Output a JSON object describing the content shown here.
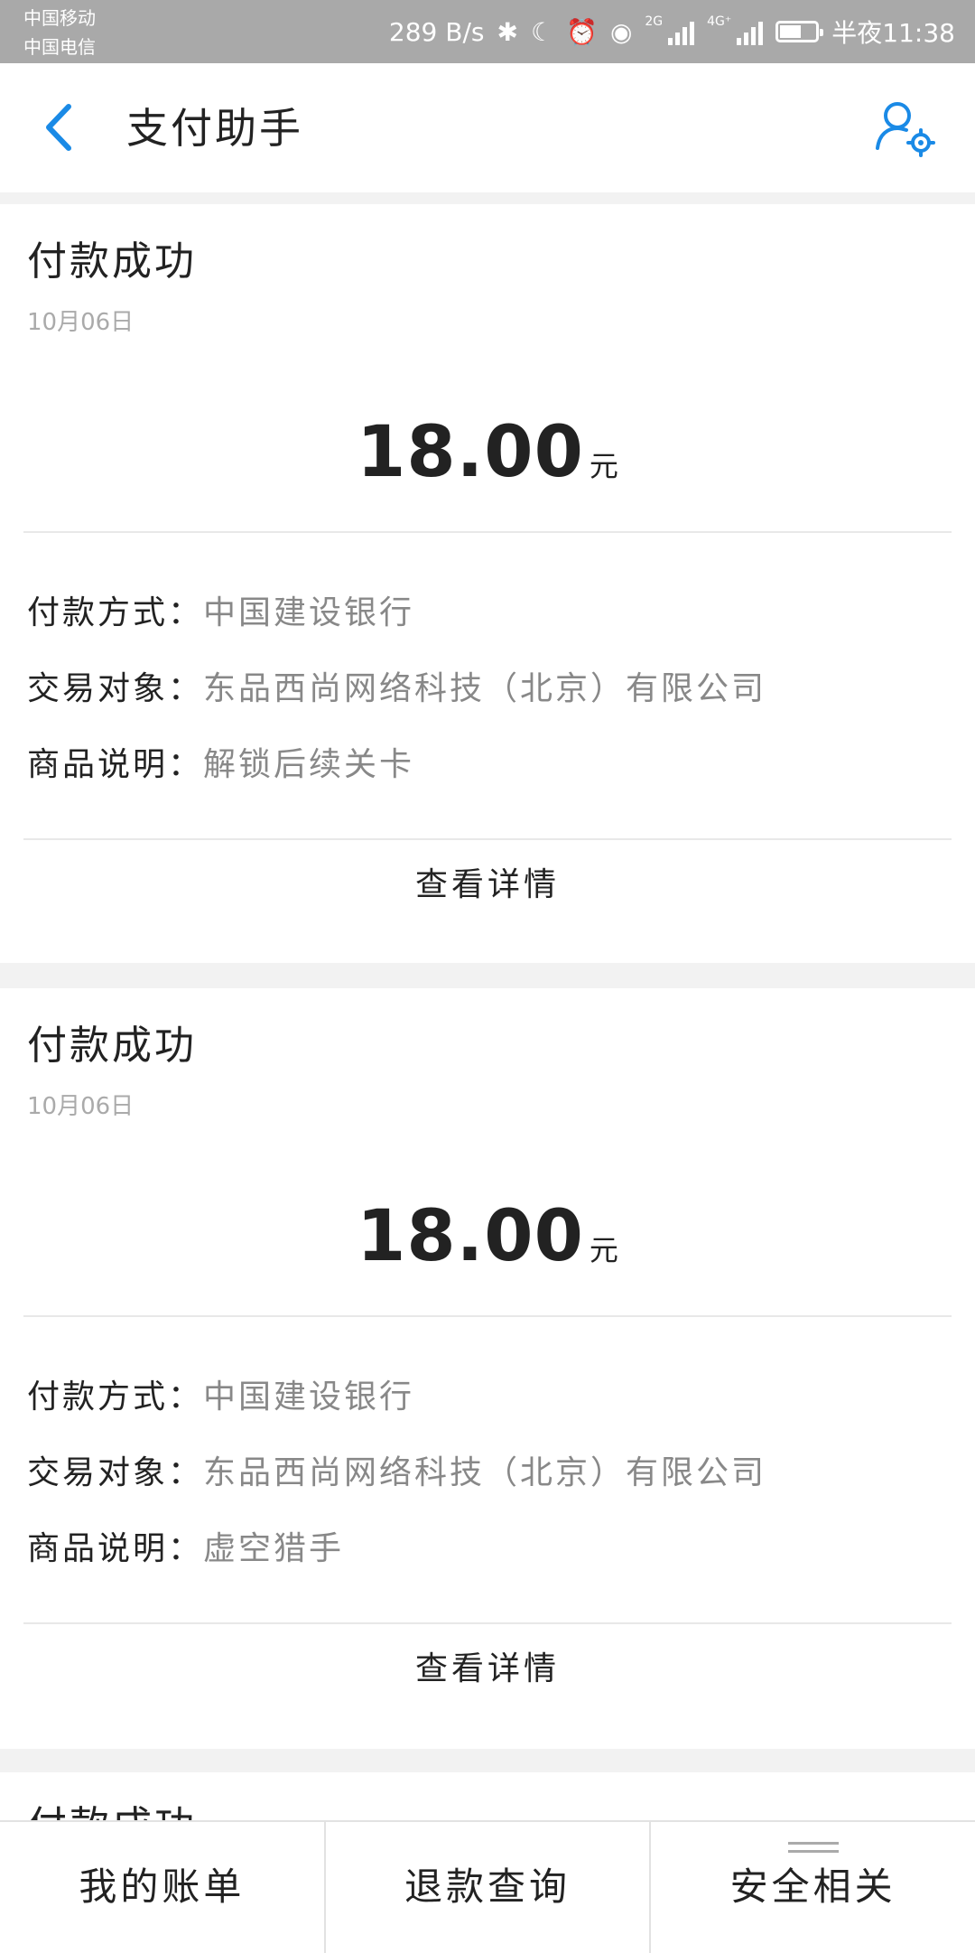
{
  "status_bar": {
    "carrier_1": "中国移动",
    "carrier_2": "中国电信",
    "net_speed": "289 B/s",
    "net_2g": "2G",
    "net_4g": "4G⁺",
    "time": "半夜11:38",
    "battery_percent": 60
  },
  "header": {
    "title": "支付助手",
    "back_icon": "chevron-left-icon",
    "settings_icon": "user-settings-icon",
    "accent_color": "#1a8ae6"
  },
  "cards": [
    {
      "title": "付款成功",
      "date": "10月06日",
      "amount": "18.00",
      "unit": "元",
      "rows": [
        {
          "label": "付款方式：",
          "value": "中国建设银行"
        },
        {
          "label": "交易对象：",
          "value": "东品西尚网络科技（北京）有限公司"
        },
        {
          "label": "商品说明：",
          "value": "解锁后续关卡"
        }
      ],
      "detail_label": "查看详情"
    },
    {
      "title": "付款成功",
      "date": "10月06日",
      "amount": "18.00",
      "unit": "元",
      "rows": [
        {
          "label": "付款方式：",
          "value": "中国建设银行"
        },
        {
          "label": "交易对象：",
          "value": "东品西尚网络科技（北京）有限公司"
        },
        {
          "label": "商品说明：",
          "value": "虚空猎手"
        }
      ],
      "detail_label": "查看详情"
    },
    {
      "title": "付款成功"
    }
  ],
  "bottom_nav": {
    "items": [
      {
        "label": "我的账单"
      },
      {
        "label": "退款查询"
      },
      {
        "label": "安全相关"
      }
    ]
  }
}
